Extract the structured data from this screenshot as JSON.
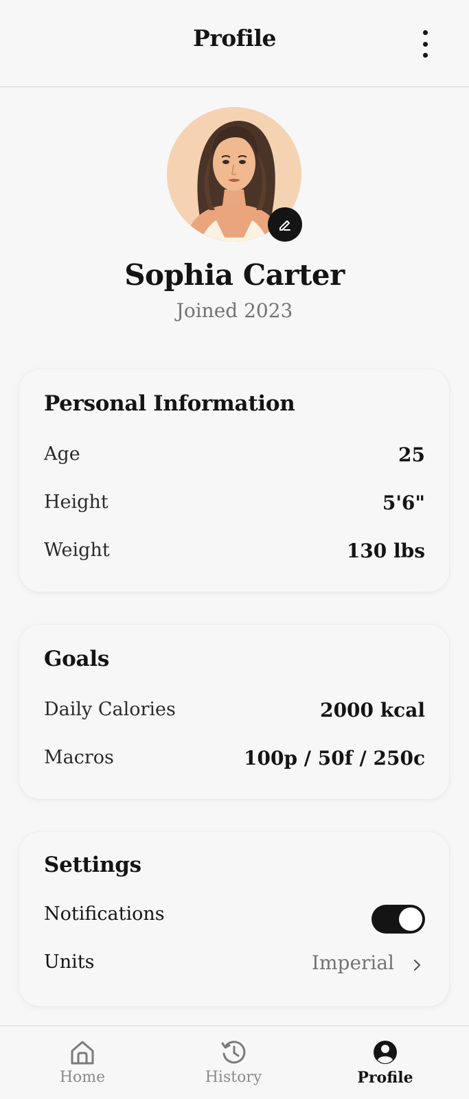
{
  "header": {
    "title": "Profile"
  },
  "profile": {
    "name": "Sophia Carter",
    "joined": "Joined 2023"
  },
  "personal_info": {
    "title": "Personal Information",
    "rows": [
      {
        "label": "Age",
        "value": "25"
      },
      {
        "label": "Height",
        "value": "5'6\""
      },
      {
        "label": "Weight",
        "value": "130 lbs"
      }
    ]
  },
  "goals": {
    "title": "Goals",
    "rows": [
      {
        "label": "Daily Calories",
        "value": "2000 kcal"
      },
      {
        "label": "Macros",
        "value": "100p / 50f / 250c"
      }
    ]
  },
  "settings": {
    "title": "Settings",
    "notifications": {
      "label": "Notifications",
      "enabled": true
    },
    "units": {
      "label": "Units",
      "value": "Imperial"
    }
  },
  "bottom_nav": {
    "items": [
      {
        "label": "Home",
        "icon": "home-icon",
        "active": false
      },
      {
        "label": "History",
        "icon": "history-icon",
        "active": false
      },
      {
        "label": "Profile",
        "icon": "profile-icon",
        "active": true
      }
    ]
  },
  "colors": {
    "accent": "#141414",
    "background": "#f7f7f7",
    "muted_text": "#737373"
  }
}
